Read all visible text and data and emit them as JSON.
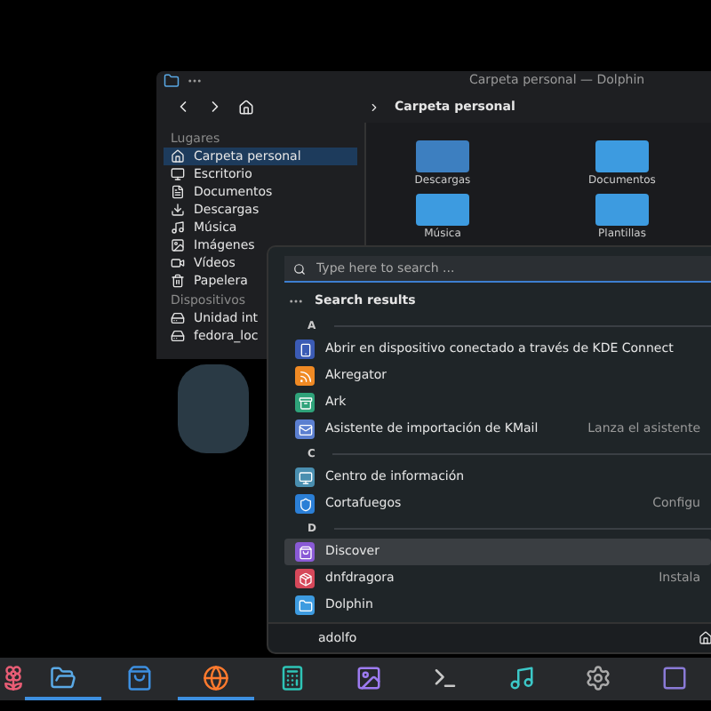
{
  "dolphin": {
    "title": "Carpeta personal — Dolphin",
    "breadcrumb": "Carpeta personal",
    "sidebar": [
      {
        "heading": "Lugares",
        "items": [
          {
            "label": "Carpeta personal",
            "selected": true
          },
          {
            "label": "Escritorio",
            "selected": false
          },
          {
            "label": "Documentos",
            "selected": false
          },
          {
            "label": "Descargas",
            "selected": false
          },
          {
            "label": "Música",
            "selected": false
          },
          {
            "label": "Imágenes",
            "selected": false
          },
          {
            "label": "Vídeos",
            "selected": false
          },
          {
            "label": "Papelera",
            "selected": false
          }
        ]
      },
      {
        "heading": "Dispositivos",
        "items": [
          {
            "label": "Unidad int",
            "selected": false
          },
          {
            "label": "fedora_loc",
            "selected": false
          }
        ]
      }
    ],
    "folders": [
      {
        "name": "Descargas"
      },
      {
        "name": "Documentos"
      },
      {
        "name": "Música"
      },
      {
        "name": "Plantillas"
      }
    ]
  },
  "launcher": {
    "search": {
      "placeholder": "Type here to search ..."
    },
    "results_heading": "Search results",
    "groups": [
      {
        "letter": "A",
        "items": [
          {
            "name": "Abrir en dispositivo conectado a través de KDE Connect",
            "selected": false
          },
          {
            "name": "Akregator",
            "selected": false
          },
          {
            "name": "Ark",
            "selected": false
          },
          {
            "name": "Asistente de importación de KMail",
            "description": "Lanza el asistente",
            "selected": false
          }
        ]
      },
      {
        "letter": "C",
        "items": [
          {
            "name": "Centro de información",
            "selected": false
          },
          {
            "name": "Cortafuegos",
            "description": "Configu",
            "selected": false
          }
        ]
      },
      {
        "letter": "D",
        "items": [
          {
            "name": "Discover",
            "selected": true
          },
          {
            "name": "dnfdragora",
            "description": "Instala",
            "selected": false
          },
          {
            "name": "Dolphin",
            "selected": false
          }
        ]
      }
    ],
    "user": "adolfo"
  },
  "taskbar": [
    {
      "running": false
    },
    {
      "running": true
    },
    {
      "running": false
    },
    {
      "running": true
    },
    {
      "running": false
    },
    {
      "running": false
    },
    {
      "running": false
    },
    {
      "running": false
    },
    {
      "running": false
    },
    {
      "running": false
    }
  ]
}
